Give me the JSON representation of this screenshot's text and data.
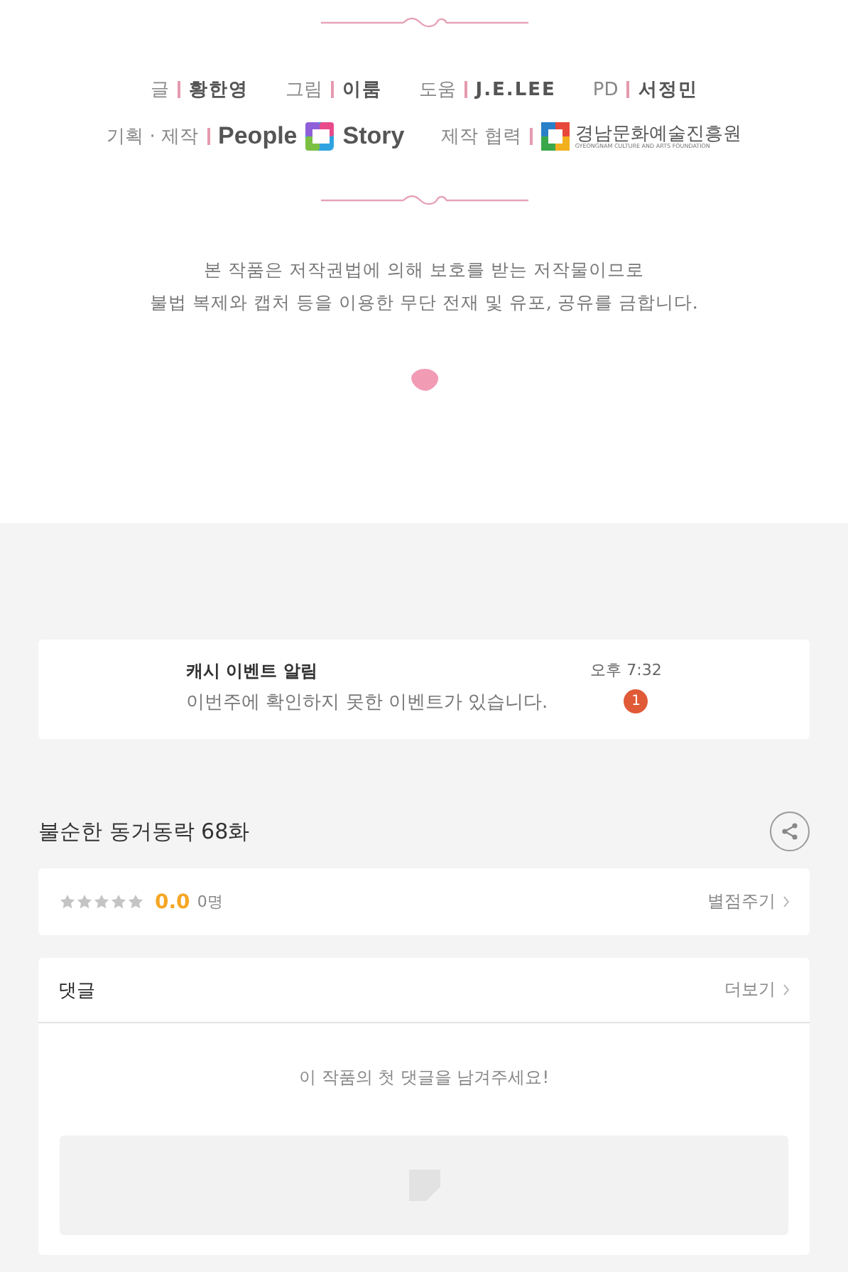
{
  "credits": [
    {
      "role": "글",
      "name": "황한영"
    },
    {
      "role": "그림",
      "name": "이룸"
    },
    {
      "role": "도움",
      "name": "J.E.LEE"
    },
    {
      "role": "PD",
      "name": "서정민"
    }
  ],
  "production": {
    "role": "기획 · 제작",
    "logo_left": "People",
    "logo_right": "Story"
  },
  "cooperation": {
    "role": "제작 협력",
    "org": "경남문화예술진흥원",
    "org_subtitle": "GYEONGNAM CULTURE AND ARTS FOUNDATION"
  },
  "notice": [
    "본 작품은 저작권법에 의해 보호를 받는 저작물이므로",
    "불법 복제와 캡처 등을 이용한 무단 전재 및 유포, 공유를 금합니다."
  ],
  "notification": {
    "title": "캐시 이벤트 알림",
    "message": "이번주에 확인하지 못한 이벤트가 있습니다.",
    "time": "오후 7:32",
    "badge": "1"
  },
  "episode": {
    "title": "불순한 동거동락 68화"
  },
  "rating": {
    "stars": 0,
    "score": "0.0",
    "count": "0명",
    "action": "별점주기"
  },
  "comments": {
    "title": "댓글",
    "more": "더보기",
    "empty": "이 작품의 첫 댓글을 남겨주세요!"
  }
}
